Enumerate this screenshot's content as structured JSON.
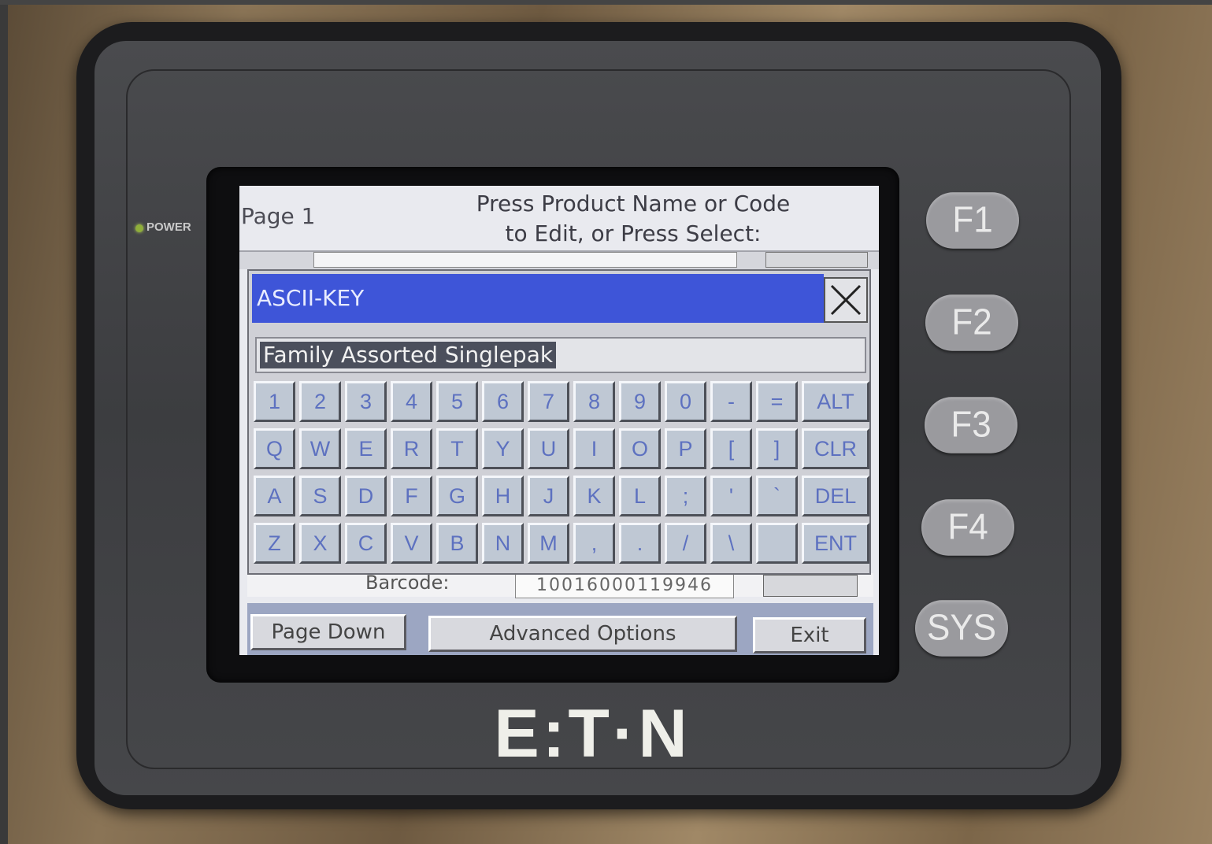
{
  "device": {
    "power_label": "POWER",
    "brand": "E:T·N",
    "function_keys": [
      "F1",
      "F2",
      "F3",
      "F4",
      "SYS"
    ]
  },
  "screen": {
    "page_label": "Page 1",
    "prompt_line1": "Press Product Name or Code",
    "prompt_line2": "to Edit, or Press Select:",
    "barcode_label": "Barcode:",
    "barcode_value": "10016000119946",
    "buttons": {
      "page_down": "Page Down",
      "advanced_options": "Advanced Options",
      "exit": "Exit"
    }
  },
  "dialog": {
    "title": "ASCII-KEY",
    "close_icon": "close-x-icon",
    "input_value": "Family Assorted Singlepak",
    "keyboard_rows": [
      [
        "1",
        "2",
        "3",
        "4",
        "5",
        "6",
        "7",
        "8",
        "9",
        "0",
        "-",
        "=",
        "ALT"
      ],
      [
        "Q",
        "W",
        "E",
        "R",
        "T",
        "Y",
        "U",
        "I",
        "O",
        "P",
        "[",
        "]",
        "CLR"
      ],
      [
        "A",
        "S",
        "D",
        "F",
        "G",
        "H",
        "J",
        "K",
        "L",
        ";",
        "'",
        "`",
        "DEL"
      ],
      [
        "Z",
        "X",
        "C",
        "V",
        "B",
        "N",
        "M",
        ",",
        ".",
        "/",
        "\\",
        "",
        "ENT"
      ]
    ]
  },
  "colors": {
    "dialog_title_bg": "#3e55d8",
    "key_text": "#5d71c0",
    "power_led": "#8fae3a"
  }
}
